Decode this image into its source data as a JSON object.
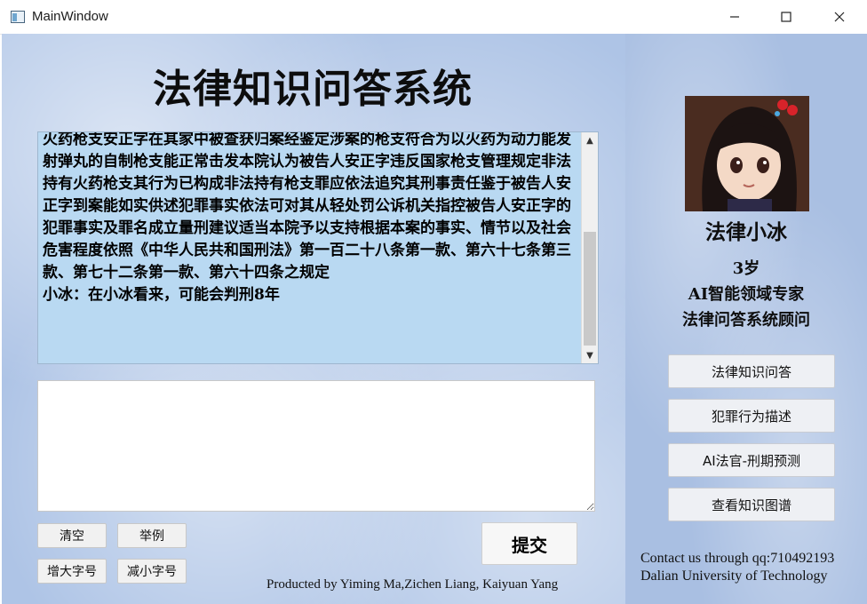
{
  "window": {
    "title": "MainWindow",
    "minimize_glyph": "—",
    "maximize_glyph": "☐",
    "close_glyph": "✕"
  },
  "main": {
    "title": "法律知识问答系统",
    "chat_output": "火药枪支安正字在其家中被查获归案经鉴定涉案的枪支符合为以火药为动力能发射弹丸的自制枪支能正常击发本院认为被告人安正字违反国家枪支管理规定非法持有火药枪支其行为已构成非法持有枪支罪应依法追究其刑事责任鉴于被告人安正字到案能如实供述犯罪事实依法可对其从轻处罚公诉机关指控被告人安正字的犯罪事实及罪名成立量刑建议适当本院予以支持根据本案的事实、情节以及社会危害程度依照《中华人民共和国刑法》第一百二十八条第一款、第六十七条第三款、第七十二条第一款、第六十四条之规定\n小冰：在小冰看来，可能会判刑8年",
    "input_value": "",
    "buttons": {
      "clear": "清空",
      "example": "举例",
      "font_up": "增大字号",
      "font_down": "减小字号",
      "submit": "提交"
    },
    "credit": "Producted by Yiming Ma,Zichen Liang, Kaiyuan Yang"
  },
  "sidebar": {
    "name": "法律小冰",
    "age": "3岁",
    "role": "AI智能领域专家",
    "position": "法律问答系统顾问",
    "menu": [
      {
        "label": "法律知识问答"
      },
      {
        "label": "犯罪行为描述"
      },
      {
        "label": "AI法官-刑期预测"
      },
      {
        "label": "查看知识图谱"
      }
    ],
    "contact_line1": "Contact us through qq:710492193",
    "contact_line2": "Dalian University of Technology"
  },
  "icons": {
    "app": "window-icon",
    "scroll_up": "▲",
    "scroll_down": "▼"
  }
}
